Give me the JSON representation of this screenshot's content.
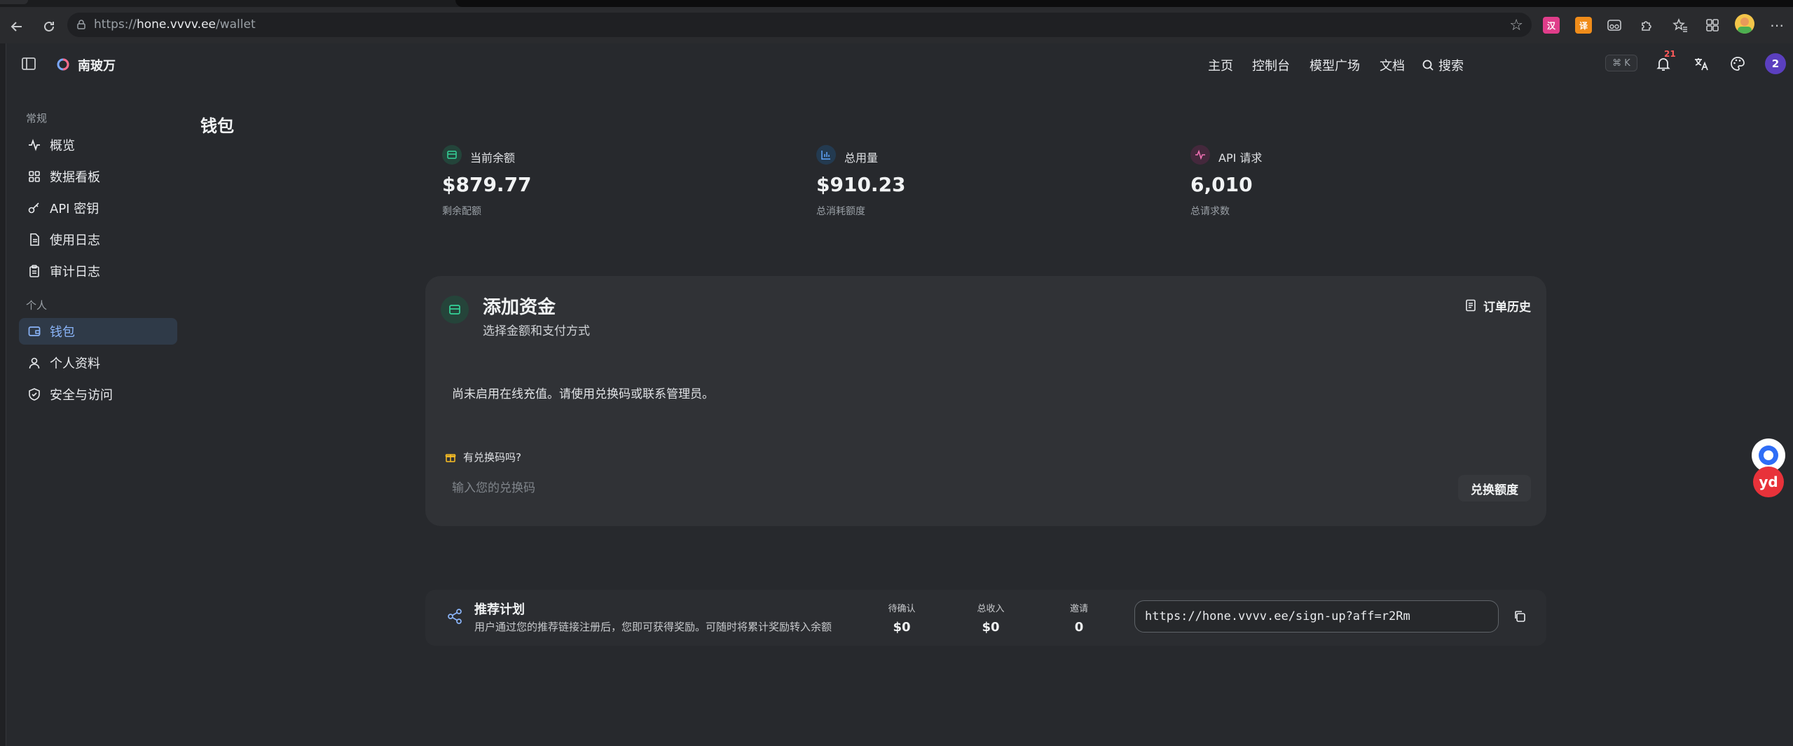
{
  "browser": {
    "url_prefix": "https://",
    "url_host": "hone.vvvv.ee",
    "url_path": "/wallet",
    "ext_badge_1": "汉",
    "ext_badge_2": "译"
  },
  "header": {
    "brand": "南玻万",
    "nav": [
      "主页",
      "控制台",
      "模型广场",
      "文档"
    ],
    "search": "搜索",
    "shortcut": "⌘ K",
    "notif_count": "21",
    "avatar": "2"
  },
  "sidebar": {
    "section_general": "常规",
    "section_personal": "个人",
    "items": [
      {
        "label": "概览"
      },
      {
        "label": "数据看板"
      },
      {
        "label": "API 密钥"
      },
      {
        "label": "使用日志"
      },
      {
        "label": "审计日志"
      },
      {
        "label": "钱包"
      },
      {
        "label": "个人资料"
      },
      {
        "label": "安全与访问"
      }
    ]
  },
  "page": {
    "title": "钱包"
  },
  "stats": [
    {
      "label": "当前余额",
      "value": "$879.77",
      "sub": "剩余配额"
    },
    {
      "label": "总用量",
      "value": "$910.23",
      "sub": "总消耗额度"
    },
    {
      "label": "API 请求",
      "value": "6,010",
      "sub": "总请求数"
    }
  ],
  "funds": {
    "title": "添加资金",
    "subtitle": "选择金额和支付方式",
    "history": "订单历史",
    "notice": "尚未启用在线充值。请使用兑换码或联系管理员。",
    "redeem_label": "有兑换码吗?",
    "redeem_placeholder": "输入您的兑换码",
    "redeem_button": "兑换额度"
  },
  "referral": {
    "title": "推荐计划",
    "desc": "用户通过您的推荐链接注册后，您即可获得奖励。可随时将累计奖励转入余额",
    "pending_label": "待确认",
    "pending_value": "$0",
    "income_label": "总收入",
    "income_value": "$0",
    "invite_label": "邀请",
    "invite_value": "0",
    "link": "https://hone.vvvv.ee/sign-up?aff=r2Rm"
  },
  "widgets": {
    "yd": "yd"
  },
  "colors": {
    "accent": "#8ab4f8",
    "green": "#34d399",
    "blue": "#60a5fa",
    "pink": "#f472b6",
    "amber": "#fbbf24"
  }
}
